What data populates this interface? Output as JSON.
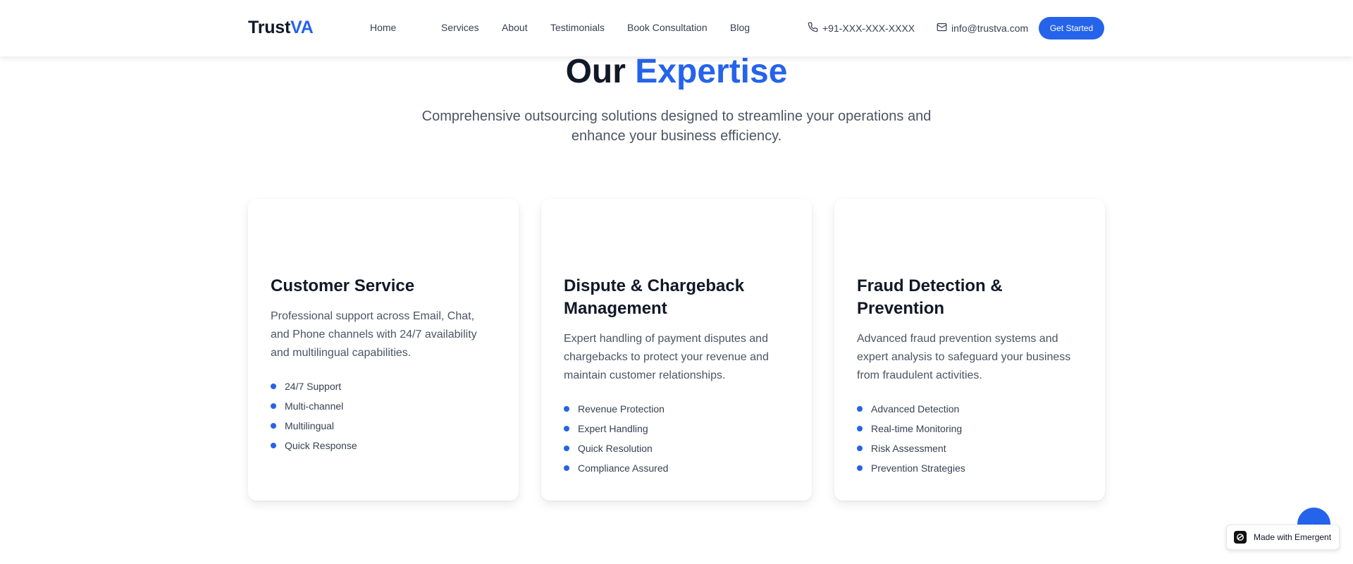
{
  "header": {
    "logo_main": "Trust",
    "logo_accent": "VA",
    "nav": [
      "Home",
      "Services",
      "About",
      "Testimonials",
      "Book Consultation",
      "Blog"
    ],
    "phone": "+91-XXX-XXX-XXXX",
    "email": "info@trustva.com",
    "cta_label": "Get Started"
  },
  "section": {
    "title_main": "Our",
    "title_accent": "Expertise",
    "subtitle": "Comprehensive outsourcing solutions designed to streamline your operations and enhance your business efficiency."
  },
  "cards": [
    {
      "title": "Customer Service",
      "description": "Professional support across Email, Chat, and Phone channels with 24/7 availability and multilingual capabilities.",
      "features": [
        "24/7 Support",
        "Multi-channel",
        "Multilingual",
        "Quick Response"
      ]
    },
    {
      "title": "Dispute & Chargeback Management",
      "description": "Expert handling of payment disputes and chargebacks to protect your revenue and maintain customer relationships.",
      "features": [
        "Revenue Protection",
        "Expert Handling",
        "Quick Resolution",
        "Compliance Assured"
      ]
    },
    {
      "title": "Fraud Detection & Prevention",
      "description": "Advanced fraud prevention systems and expert analysis to safeguard your business from fraudulent activities.",
      "features": [
        "Advanced Detection",
        "Real-time Monitoring",
        "Risk Assessment",
        "Prevention Strategies"
      ]
    }
  ],
  "fab": {
    "icon": "arrow-left-icon",
    "glyph": "←"
  },
  "badge": {
    "label": "Made with Emergent",
    "icon": "emergent-logo-icon"
  },
  "colors": {
    "accent": "#2563eb",
    "text": "#111827",
    "muted": "#4b5563"
  }
}
